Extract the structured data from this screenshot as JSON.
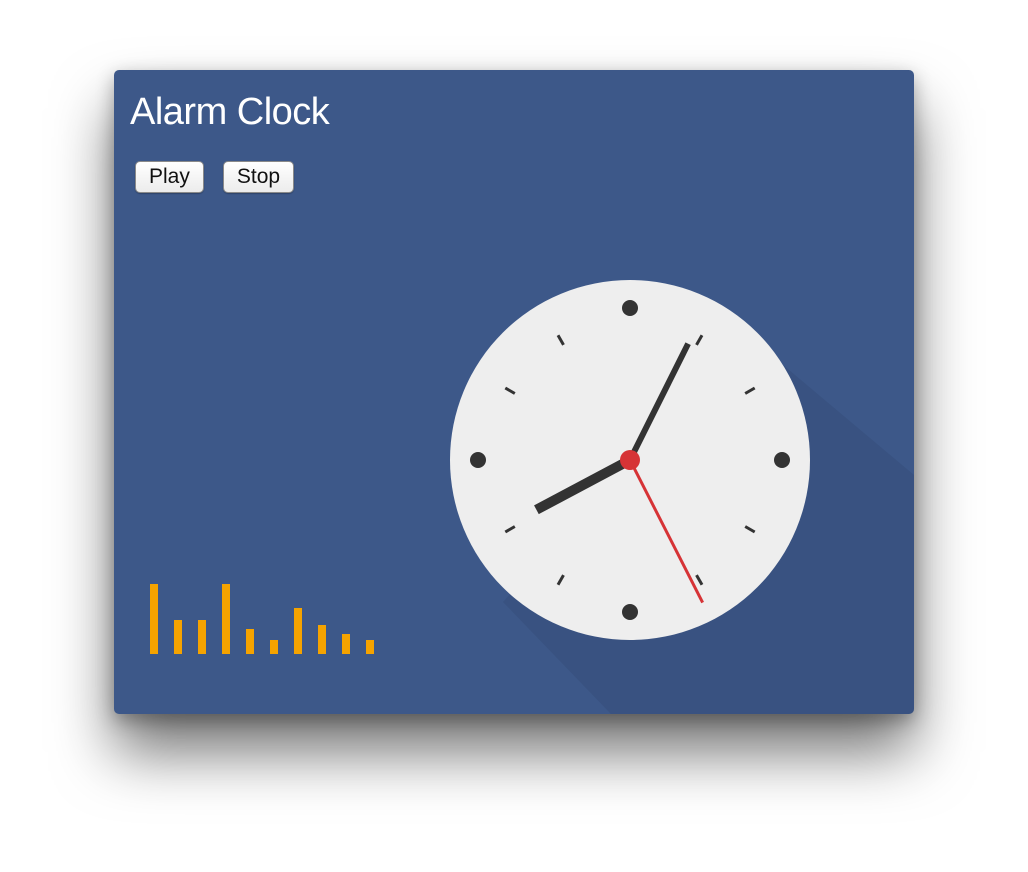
{
  "app": {
    "title": "Alarm Clock"
  },
  "controls": {
    "play_label": "Play",
    "stop_label": "Stop"
  },
  "clock": {
    "time": {
      "hours": 8,
      "minutes": 4,
      "seconds": 25.5
    },
    "face_color": "#eeeeee",
    "hand_color": "#333333",
    "second_hand_color": "#d63336",
    "hub_color": "#d63336",
    "hour_markers": "dots-at-quarters, ticks-elsewhere"
  },
  "visualizer": {
    "bar_color": "#f5a300",
    "levels": [
      1.0,
      0.48,
      0.48,
      1.0,
      0.35,
      0.2,
      0.66,
      0.41,
      0.29,
      0.2
    ]
  },
  "theme": {
    "background": "#3d5889",
    "title_color": "#ffffff"
  }
}
